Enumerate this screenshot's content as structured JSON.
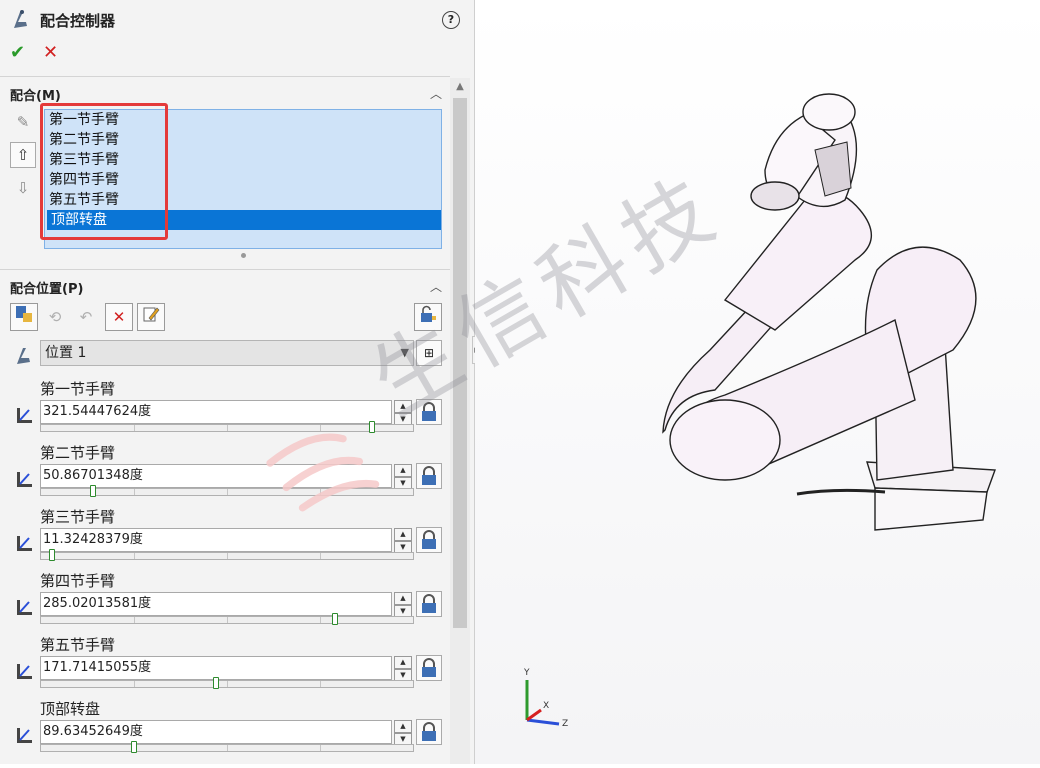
{
  "panel": {
    "title": "配合控制器",
    "help_label": "?",
    "ok_label": "✔",
    "cancel_label": "✕"
  },
  "mates_section": {
    "title": "配合(M)",
    "items": [
      {
        "label": "第一节手臂",
        "selected": false
      },
      {
        "label": "第二节手臂",
        "selected": false
      },
      {
        "label": "第三节手臂",
        "selected": false
      },
      {
        "label": "第四节手臂",
        "selected": false
      },
      {
        "label": "第五节手臂",
        "selected": false
      },
      {
        "label": "顶部转盘",
        "selected": true
      }
    ]
  },
  "positions_section": {
    "title": "配合位置(P)",
    "selected_position": "位置 1",
    "joints": [
      {
        "label": "第一节手臂",
        "value": "321.54447624度",
        "fraction": 0.89
      },
      {
        "label": "第二节手臂",
        "value": "50.86701348度",
        "fraction": 0.14
      },
      {
        "label": "第三节手臂",
        "value": "11.32428379度",
        "fraction": 0.03
      },
      {
        "label": "第四节手臂",
        "value": "285.02013581度",
        "fraction": 0.79
      },
      {
        "label": "第五节手臂",
        "value": "171.71415055度",
        "fraction": 0.47
      },
      {
        "label": "顶部转盘",
        "value": "89.63452649度",
        "fraction": 0.25
      }
    ]
  },
  "viewport": {
    "watermark_text": "生信科技",
    "triad_labels": {
      "x": "X",
      "y": "Y",
      "z": "Z"
    }
  },
  "colors": {
    "accent": "#0a75d6",
    "list_bg": "#cfe3f8",
    "highlight_box": "#e43a3a",
    "ok": "#2a9a2a",
    "cancel": "#d12020"
  }
}
